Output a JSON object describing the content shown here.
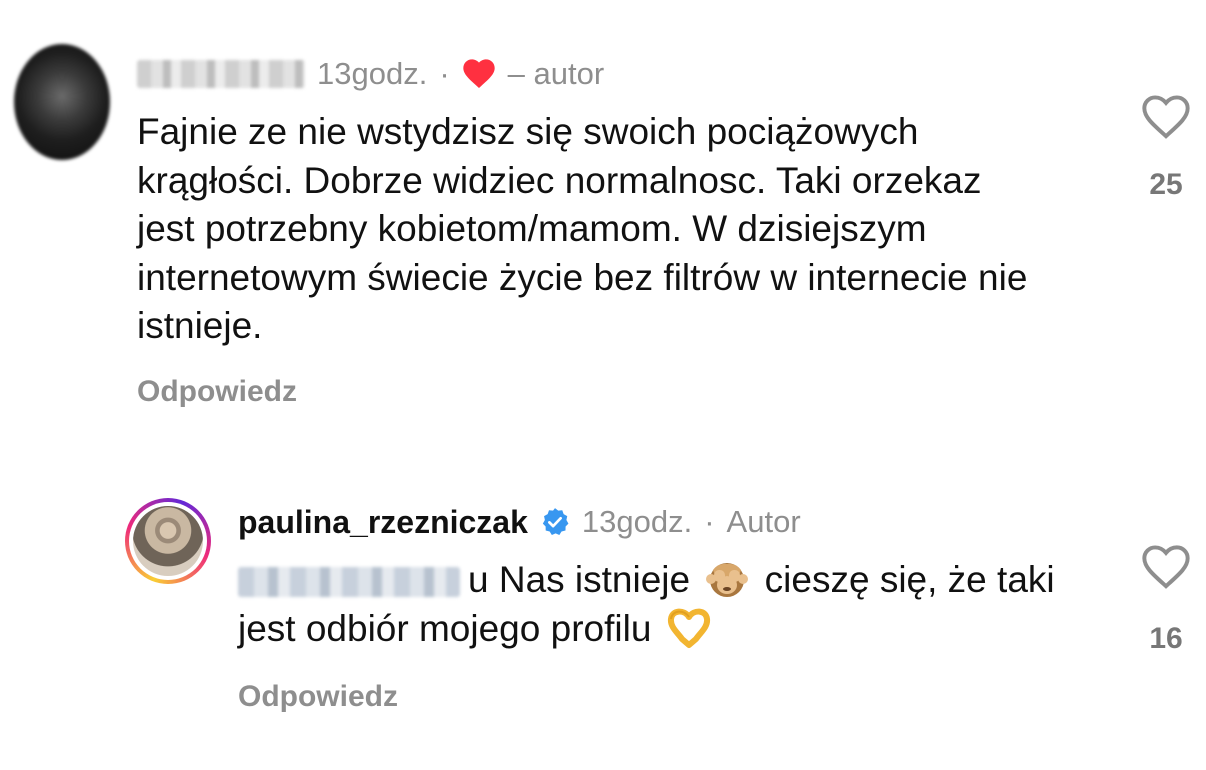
{
  "comments": [
    {
      "time": "13godz.",
      "dot": "·",
      "author_note": "– autor",
      "text": "Fajnie ze nie wstydzisz się swoich pociążowych krągłości. Dobrze widziec normalnosc. Taki orzekaz jest potrzebny kobietom/mamom. W dzisiejszym internetowym świecie życie bez filtrów w internecie nie istnieje.",
      "reply_label": "Odpowiedz",
      "likes": "25",
      "liked_by_author_icon": "red-heart-icon"
    },
    {
      "username": "paulina_rzezniczak",
      "verified_icon": "verified-badge-icon",
      "time": "13godz.",
      "dot": "·",
      "author_note": "Autor",
      "text_part1": "u Nas istnieje",
      "text_part2": "cieszę się, że taki jest odbiór mojego profilu",
      "emoji1": "see-no-evil-monkey-icon",
      "emoji2": "heart-hands-icon",
      "reply_label": "Odpowiedz",
      "likes": "16"
    }
  ],
  "colors": {
    "meta_gray": "#8e8e8e",
    "text": "#111111",
    "heart_red": "#ff3040",
    "verified_blue": "#3897f0"
  }
}
